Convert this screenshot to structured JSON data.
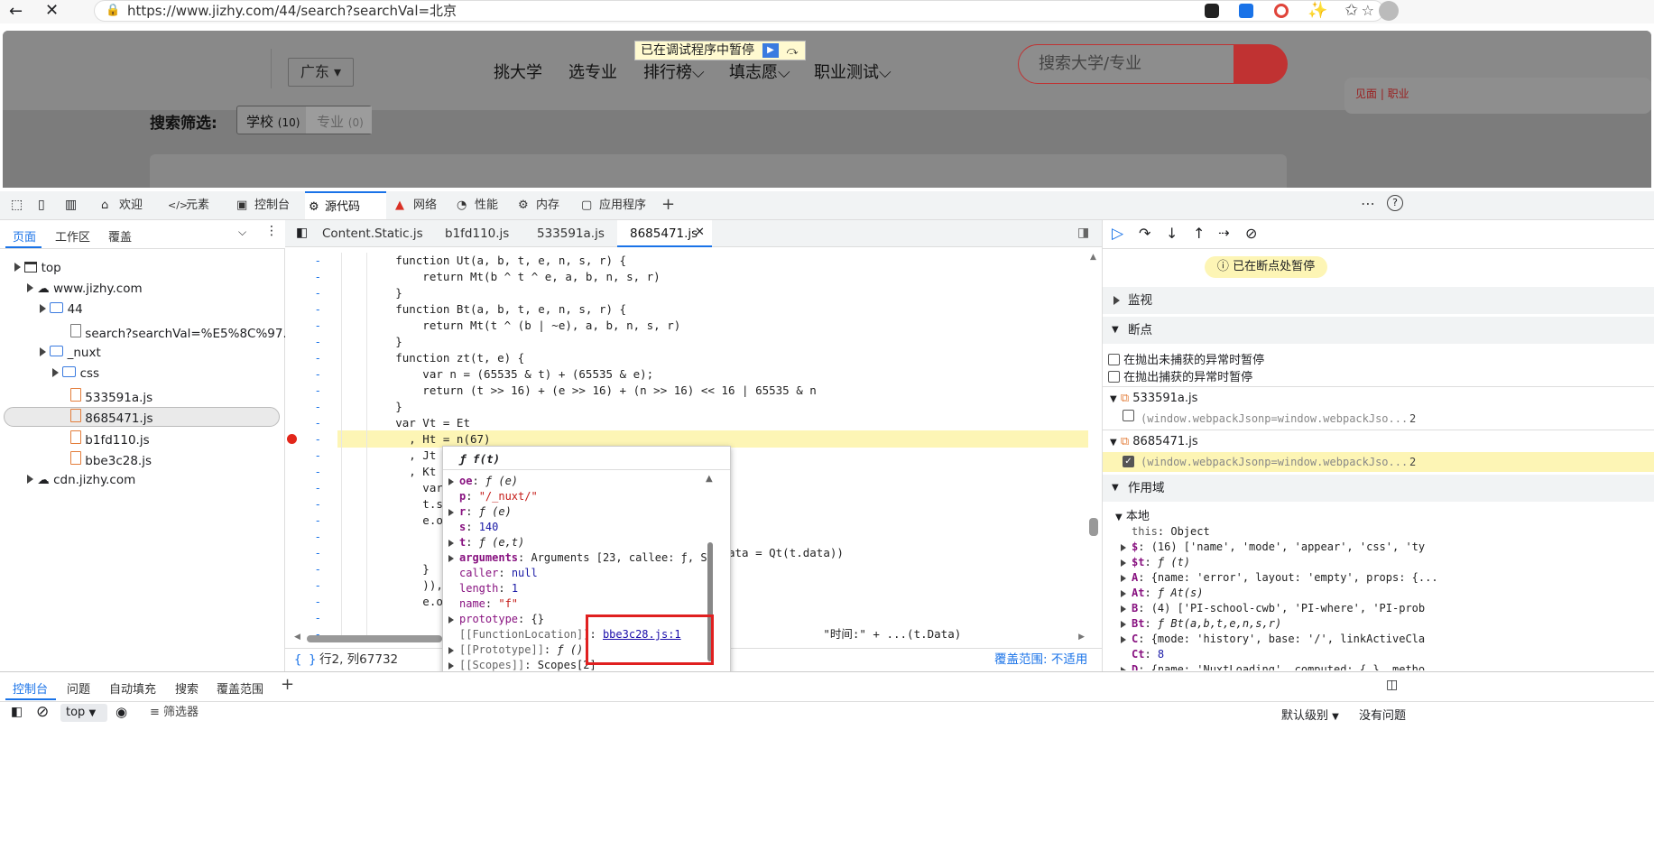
{
  "browser": {
    "url": "https://www.jizhy.com/44/search?searchVal=北京"
  },
  "page": {
    "province": "广东",
    "nav": [
      "挑大学",
      "选专业",
      "排行榜",
      "填志愿",
      "职业测试"
    ],
    "search_placeholder": "搜索大学/专业",
    "paused_banner": "已在调试程序中暂停",
    "filter_label": "搜索筛选:",
    "filter_tabs": [
      "学校",
      "(10)",
      "专业",
      "(0)"
    ],
    "side_text": "见面 | 职业"
  },
  "devtools": {
    "tabs": [
      "欢迎",
      "元素",
      "控制台",
      "源代码",
      "网络",
      "性能",
      "内存",
      "应用程序"
    ],
    "left_tabs": [
      "页面",
      "工作区",
      "覆盖"
    ],
    "tree": {
      "top": "top",
      "domain": "www.jizhy.com",
      "folder44": "44",
      "search_file": "search?searchVal=%E5%8C%97...",
      "nuxt": "_nuxt",
      "css": "css",
      "files": [
        "533591a.js",
        "8685471.js",
        "b1fd110.js",
        "bbe3c28.js"
      ],
      "cdn": "cdn.jizhy.com"
    },
    "file_tabs": [
      "Content.Static.js",
      "b1fd110.js",
      "533591a.js",
      "8685471.js"
    ],
    "code": [
      {
        "g": "-",
        "t": "        function Ut(a, b, t, e, n, s, r) {"
      },
      {
        "g": "-",
        "t": "            return Mt(b ^ t ^ e, a, b, n, s, r)"
      },
      {
        "g": "-",
        "t": "        }"
      },
      {
        "g": "-",
        "t": "        function Bt(a, b, t, e, n, s, r) {"
      },
      {
        "g": "-",
        "t": "            return Mt(t ^ (b | ~e), a, b, n, s, r)"
      },
      {
        "g": "-",
        "t": "        }"
      },
      {
        "g": "-",
        "t": "        function zt(t, e) {"
      },
      {
        "g": "-",
        "t": "            var n = (65535 & t) + (65535 & e);"
      },
      {
        "g": "-",
        "t": "            return (t >> 16) + (e >> 16) + (n >> 16) << 16 | 65535 & n"
      },
      {
        "g": "-",
        "t": "        }"
      },
      {
        "g": "-",
        "t": "        var Vt = Et"
      },
      {
        "g": "-",
        "t": "          , Ht = n(67)"
      },
      {
        "g": "-",
        "t": "          , Jt ="
      },
      {
        "g": "-",
        "t": "          , Kt ="
      },
      {
        "g": "-",
        "t": "            var"
      },
      {
        "g": "-",
        "t": "            t.st"
      },
      {
        "g": "-",
        "t": "            e.or"
      },
      {
        "g": "-",
        "t": ""
      },
      {
        "g": "-",
        "t": "                                          \" === e && (t.data = Qt(t.data))"
      },
      {
        "g": "-",
        "t": "            }"
      },
      {
        "g": "-",
        "t": "            )),"
      },
      {
        "g": "-",
        "t": "            e.or"
      },
      {
        "g": "-",
        "t": ""
      },
      {
        "g": "-",
        "t": "                                                                       \"时间:\" + ...(t.Data) "
      }
    ],
    "status": {
      "braces": "{ }",
      "position": "行2, 列67732",
      "coverage": "覆盖范围: 不适用"
    },
    "popover": {
      "title": "ƒ f(t)",
      "rows": [
        {
          "k": "oe",
          "v": "ƒ (e)",
          "exp": true
        },
        {
          "k": "p",
          "v": "\"/_nuxt/\"",
          "exp": false
        },
        {
          "k": "r",
          "v": "ƒ (e)",
          "exp": true
        },
        {
          "k": "s",
          "v": "140",
          "exp": false
        },
        {
          "k": "t",
          "v": "ƒ (e,t)",
          "exp": true
        },
        {
          "k": "arguments",
          "v": "Arguments [23, callee: ƒ, S",
          "exp": true
        },
        {
          "k": "caller",
          "v": "null",
          "exp": false
        },
        {
          "k": "length",
          "v": "1",
          "exp": false
        },
        {
          "k": "name",
          "v": "\"f\"",
          "exp": false
        },
        {
          "k": "prototype",
          "v": "{}",
          "exp": true
        },
        {
          "k": "[[FunctionLocation]]",
          "v": "bbe3c28.js:1",
          "exp": false
        },
        {
          "k": "[[Prototype]]",
          "v": "ƒ ()",
          "exp": true
        },
        {
          "k": "[[Scopes]]",
          "v": "Scopes[2]",
          "exp": true
        }
      ]
    },
    "right": {
      "paused": "已在断点处暂停",
      "watch": "监视",
      "breakpoints": "断点",
      "chk_uncaught": "在抛出未捕获的异常时暂停",
      "chk_caught": "在抛出捕获的异常时暂停",
      "bp_files": [
        {
          "file": "533591a.js",
          "code": "(window.webpackJsonp=window.webpackJso...",
          "line": "2",
          "checked": false
        },
        {
          "file": "8685471.js",
          "code": "(window.webpackJsonp=window.webpackJso...",
          "line": "2",
          "checked": true
        }
      ],
      "scope": "作用域",
      "local": "本地",
      "scope_rows": [
        {
          "k": "this",
          "v": "Object",
          "exp": false
        },
        {
          "k": "$",
          "v": "(16) ['name', 'mode', 'appear', 'css', 'ty",
          "exp": true
        },
        {
          "k": "$t",
          "v": "ƒ (t)",
          "exp": true
        },
        {
          "k": "A",
          "v": "{name: 'error', layout: 'empty', props: {...",
          "exp": true
        },
        {
          "k": "At",
          "v": "ƒ At(s)",
          "exp": true
        },
        {
          "k": "B",
          "v": "(4) ['PI-school-cwb', 'PI-where', 'PI-prob",
          "exp": true
        },
        {
          "k": "Bt",
          "v": "ƒ Bt(a,b,t,e,n,s,r)",
          "exp": true
        },
        {
          "k": "C",
          "v": "{mode: 'history', base: '/', linkActiveCla",
          "exp": true
        },
        {
          "k": "Ct",
          "v": "8",
          "exp": false
        },
        {
          "k": "D",
          "v": "{name: 'NuxtLoading', computed: {…}, metho",
          "exp": true
        }
      ]
    },
    "drawer": {
      "tabs": [
        "控制台",
        "问题",
        "自动填充",
        "搜索",
        "覆盖范围"
      ],
      "context": "top",
      "filter": "筛选器",
      "level": "默认级别",
      "issues": "没有问题"
    }
  }
}
